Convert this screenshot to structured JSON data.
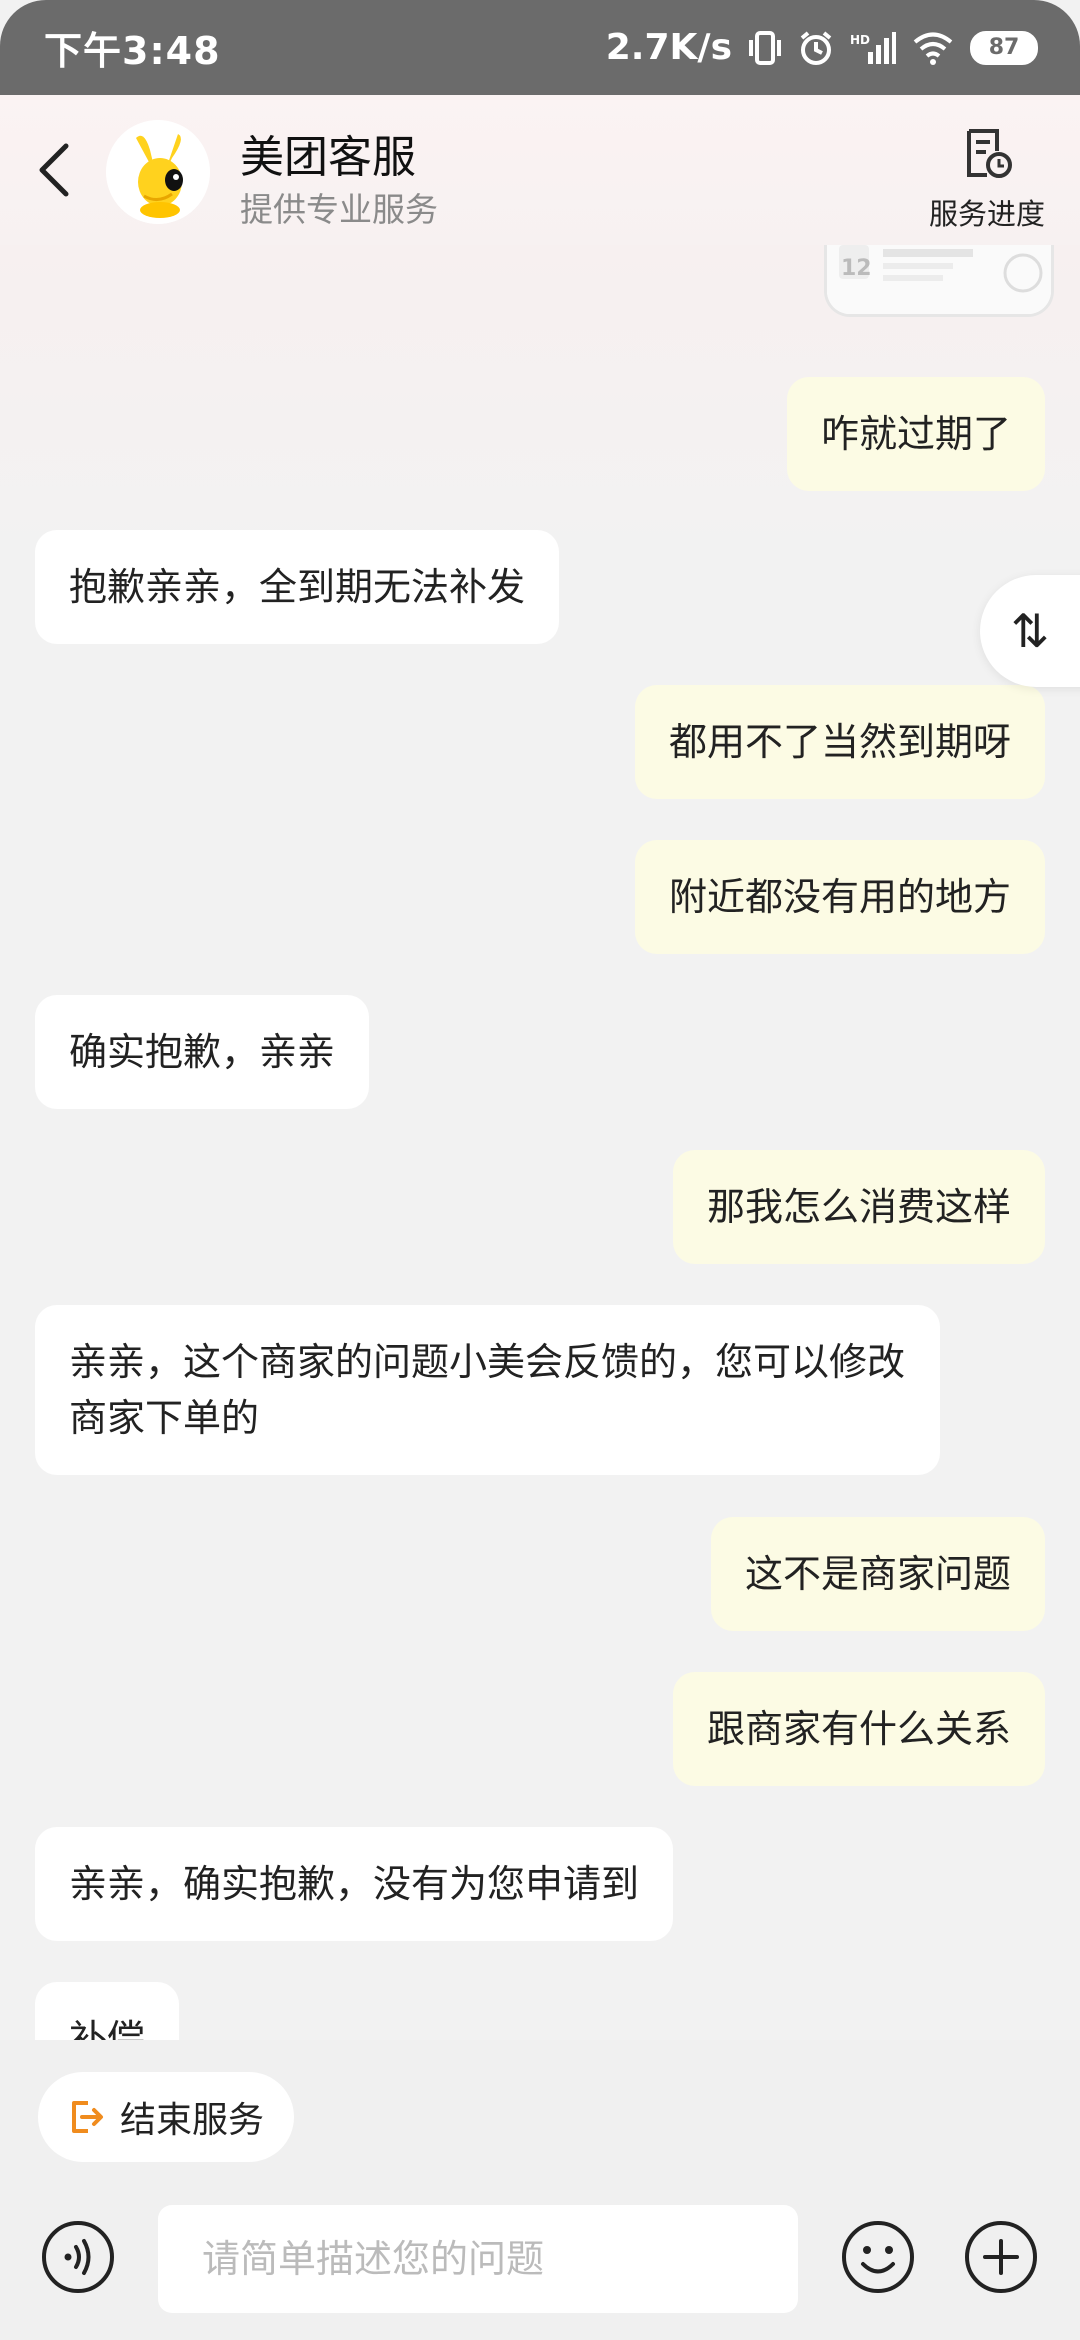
{
  "status_bar": {
    "time": "下午3:48",
    "net_speed": "2.7K/s",
    "battery": "87"
  },
  "header": {
    "title": "美团客服",
    "subtitle": "提供专业服务",
    "progress_label": "服务进度"
  },
  "messages": [
    {
      "side": "right",
      "text": "咋就过期了"
    },
    {
      "side": "left",
      "text": "抱歉亲亲，全到期无法补发"
    },
    {
      "side": "right",
      "text": "都用不了当然到期呀"
    },
    {
      "side": "right",
      "text": "附近都没有用的地方"
    },
    {
      "side": "left",
      "text": "确实抱歉，亲亲"
    },
    {
      "side": "right",
      "text": "那我怎么消费这样"
    },
    {
      "side": "left",
      "text": "亲亲，这个商家的问题小美会反馈的，您可以修改商家下单的"
    },
    {
      "side": "right",
      "text": "这不是商家问题"
    },
    {
      "side": "right",
      "text": "跟商家有什么关系"
    },
    {
      "side": "left",
      "text": "亲亲，确实抱歉，没有为您申请到"
    },
    {
      "side": "left",
      "text": "补偿"
    }
  ],
  "bottom": {
    "end_service_label": "结束服务",
    "input_placeholder": "请简单描述您的问题"
  },
  "colors": {
    "accent": "#f08c1e",
    "bubble_right": "#fcfbe4",
    "bubble_left": "#ffffff"
  },
  "icons": {
    "scroll_toggle": "⇅"
  }
}
